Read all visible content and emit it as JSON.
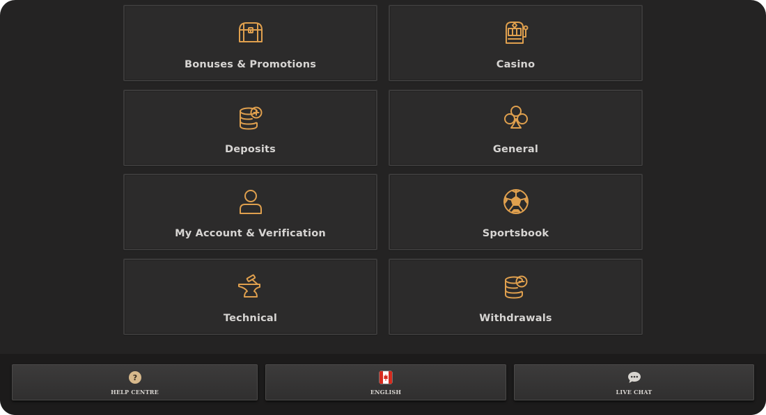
{
  "accent_color": "#e0a04e",
  "categories": [
    {
      "label": "Bonuses & Promotions",
      "icon": "treasure-chest-icon"
    },
    {
      "label": "Casino",
      "icon": "slot-machine-icon"
    },
    {
      "label": "Deposits",
      "icon": "coins-plus-icon"
    },
    {
      "label": "General",
      "icon": "club-icon"
    },
    {
      "label": "My Account & Verification",
      "icon": "user-icon"
    },
    {
      "label": "Sportsbook",
      "icon": "soccer-ball-icon"
    },
    {
      "label": "Technical",
      "icon": "anvil-icon"
    },
    {
      "label": "Withdrawals",
      "icon": "coins-minus-icon"
    }
  ],
  "footer": {
    "help": {
      "label": "HELP CENTRE",
      "icon": "question-icon"
    },
    "language": {
      "label": "ENGLISH",
      "icon": "canada-flag-icon"
    },
    "chat": {
      "label": "LIVE CHAT",
      "icon": "chat-bubble-icon"
    }
  }
}
